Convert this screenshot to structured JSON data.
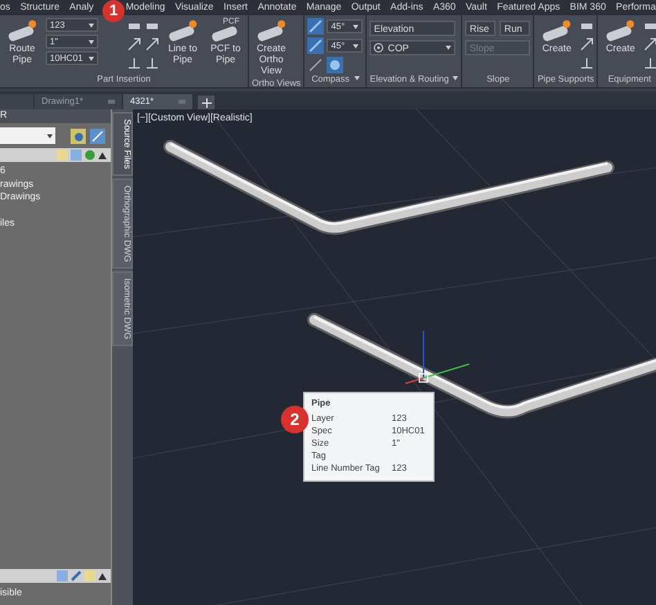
{
  "ribbon_tabs": [
    {
      "label": "os"
    },
    {
      "label": "Structure"
    },
    {
      "label": "Analy"
    },
    {
      "label": "Modeling"
    },
    {
      "label": "Visualize"
    },
    {
      "label": "Insert"
    },
    {
      "label": "Annotate"
    },
    {
      "label": "Manage"
    },
    {
      "label": "Output"
    },
    {
      "label": "Add-ins"
    },
    {
      "label": "A360"
    },
    {
      "label": "Vault"
    },
    {
      "label": "Featured Apps"
    },
    {
      "label": "BIM 360"
    },
    {
      "label": "Performa"
    }
  ],
  "ribbon_panels": [
    {
      "title": "Part Insertion",
      "expander": false,
      "items": [
        {
          "kind": "large-button",
          "label": "Route Pipe"
        },
        {
          "kind": "dropdowns",
          "values": [
            "123",
            "1\"",
            "10HC01"
          ]
        },
        {
          "kind": "tool-column"
        },
        {
          "kind": "tool-column"
        },
        {
          "kind": "large-button",
          "label": "Line to Pipe"
        },
        {
          "kind": "large-button",
          "label": "PCF to Pipe",
          "icon_text": "PCF"
        }
      ]
    },
    {
      "title": "Ortho Views",
      "expander": false,
      "items": [
        {
          "kind": "large-button",
          "label": "Create Ortho View"
        }
      ]
    },
    {
      "title": "Compass",
      "expander": true,
      "items": [
        {
          "kind": "angle-dropdowns",
          "values": [
            "45°",
            "45°"
          ]
        }
      ]
    },
    {
      "title": "Elevation & Routing",
      "expander": true,
      "items": [
        {
          "kind": "fields",
          "fields": [
            {
              "value": "Elevation",
              "kind": "text",
              "disabled": false
            },
            {
              "value": "COP",
              "kind": "dropdown"
            }
          ]
        }
      ]
    },
    {
      "title": "Slope",
      "expander": false,
      "items": [
        {
          "kind": "fields",
          "fields": [
            {
              "value": "Rise",
              "kind": "text",
              "disabled": false
            },
            {
              "value": "Run",
              "kind": "text",
              "disabled": false
            },
            {
              "value": "Slope",
              "kind": "text",
              "disabled": true
            }
          ]
        }
      ]
    },
    {
      "title": "Pipe Supports",
      "expander": false,
      "items": [
        {
          "kind": "large-button",
          "label": "Create"
        },
        {
          "kind": "tool-column"
        }
      ]
    },
    {
      "title": "Equipment",
      "expander": false,
      "items": [
        {
          "kind": "large-button",
          "label": "Create"
        },
        {
          "kind": "tool-column"
        }
      ]
    }
  ],
  "document_tabs": [
    {
      "selected": false
    },
    {
      "label": "Drawing1*",
      "selected": false
    },
    {
      "label": "4321*",
      "selected": true
    }
  ],
  "left_panel": {
    "title": "R",
    "tree": [
      {
        "label": "6"
      },
      {
        "label": "rawings"
      },
      {
        "label": "Drawings"
      },
      {
        "label": "iles"
      }
    ],
    "bottom_item": "isible"
  },
  "palette_tabs": [
    {
      "label": "Source Files",
      "selected": true
    },
    {
      "label": "Orthographic DWG",
      "selected": false
    },
    {
      "label": "Isometric DWG",
      "selected": false
    }
  ],
  "viewport": {
    "label": "[−][Custom View][Realistic]"
  },
  "tooltip": {
    "title": "Pipe",
    "rows": [
      {
        "label": "Layer",
        "value": "123"
      },
      {
        "label": "Spec",
        "value": "10HC01"
      },
      {
        "label": "Size",
        "value": "1\""
      },
      {
        "label": "Tag"
      },
      {
        "label": "Line Number Tag",
        "value": "123"
      }
    ]
  },
  "callouts": [
    {
      "number": "1"
    },
    {
      "number": "2"
    }
  ]
}
